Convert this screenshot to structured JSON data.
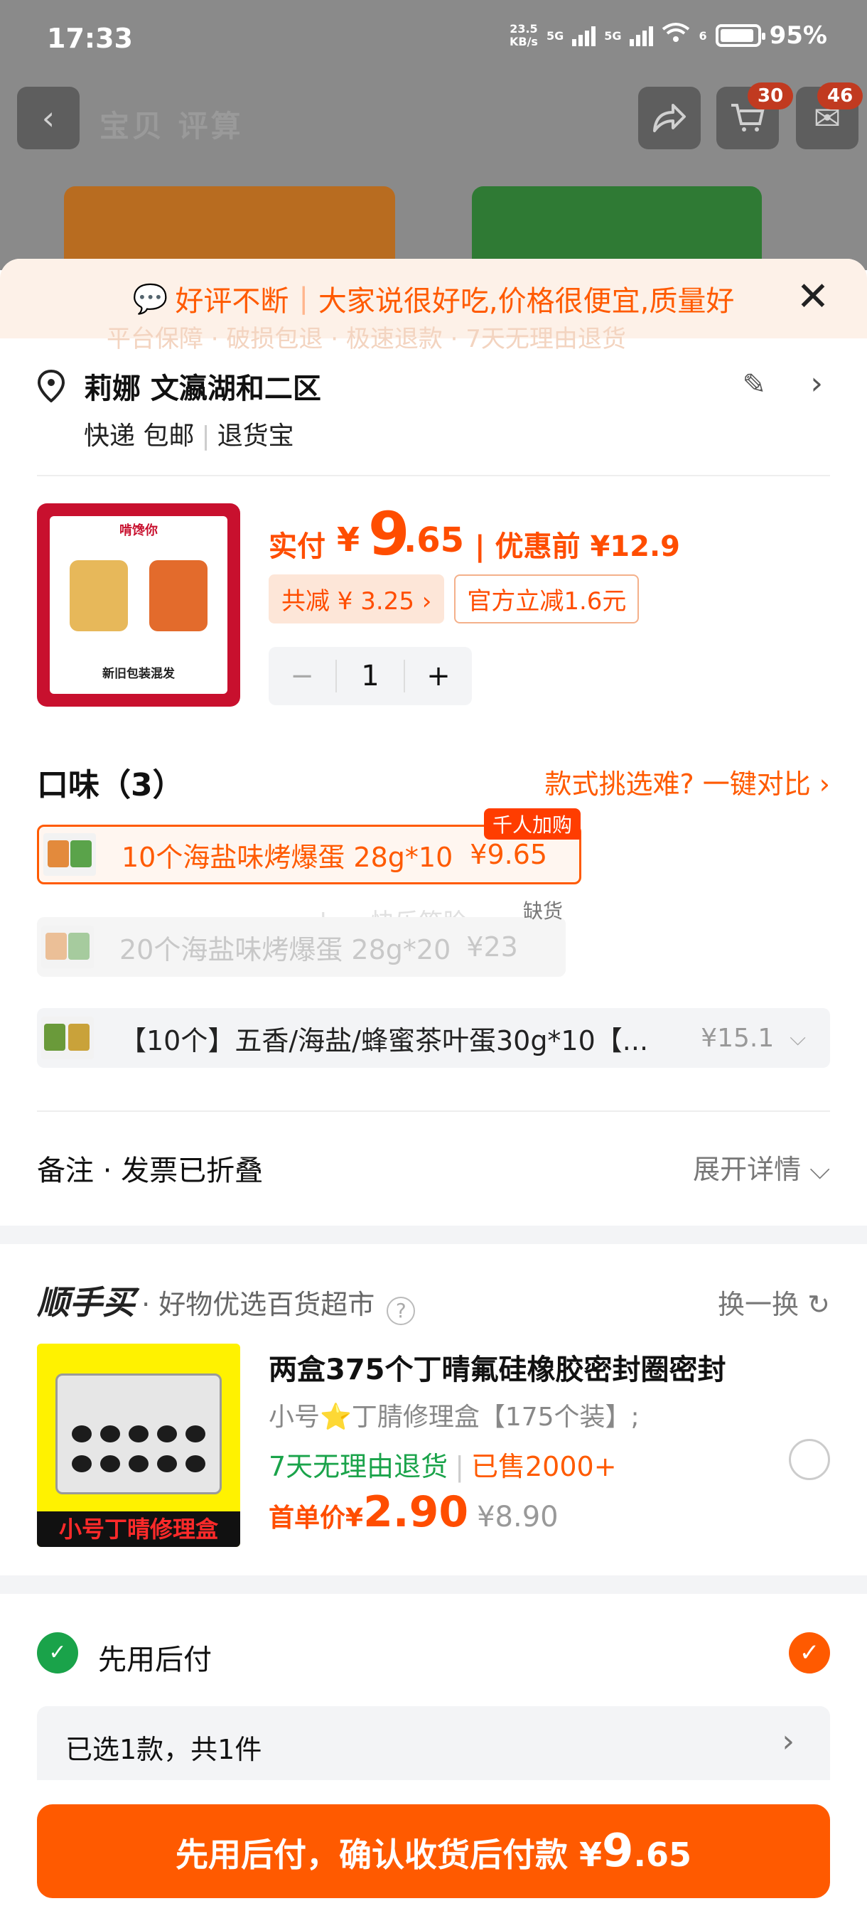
{
  "status_bar": {
    "time": "17:33",
    "net_speed": "23.5",
    "net_unit": "KB/s",
    "sig1": "5G",
    "sig2": "5G",
    "wifi_sub": "6",
    "battery": "95%"
  },
  "header": {
    "title": "宝贝 评算",
    "cart_count": "30",
    "msg_count": "46"
  },
  "banner": {
    "prefix": "好评不断",
    "text": "大家说很好吃,价格很便宜,质量好",
    "ghost": "平台保障 · 破损包退 · 极速退款 · 7天无理由退货"
  },
  "address": {
    "name": "莉娜 文瀛湖和二区",
    "delivery": "快递 包邮",
    "service": "退货宝"
  },
  "product": {
    "brand": "啃馋你",
    "image_caption": "新旧包装混发",
    "pay_label": "实付",
    "currency": "¥",
    "price_int": "9",
    "price_dec": ".65",
    "orig_price": "| 优惠前 ¥12.9",
    "discount_tag": "共减 ¥ 3.25 ›",
    "official_tag": "官方立减1.6元",
    "qty_minus": "−",
    "qty": "1",
    "qty_plus": "+"
  },
  "flavor": {
    "title": "口味（3）",
    "compare": "款式挑选难? 一键对比 ›",
    "options": [
      {
        "label": "10个海盐味烤爆蛋 28g*10",
        "price": "¥9.65",
        "badge": "千人加购"
      },
      {
        "label": "20个海盐味烤爆蛋 28g*20",
        "price": "¥23",
        "badge": "缺货"
      },
      {
        "label": "【10个】五香/海盐/蜂蜜茶叶蛋30g*10【...",
        "price": "¥15.1"
      }
    ],
    "watermark": "love快乐笑脸"
  },
  "note": {
    "label": "备注 · 发票已折叠",
    "expand": "展开详情"
  },
  "recommend": {
    "logo": "顺手买",
    "subtitle": "· 好物优选百货超市",
    "swap": "换一换",
    "image_label": "小号丁晴修理盒",
    "title": "两盒375个丁晴氟硅橡胶密封圈密封",
    "spec": "小号⭐丁腈修理盒【175个装】;",
    "return_policy": "7天无理由退货",
    "sold": "已售2000+",
    "first_label": "首单价¥",
    "first_price": "2.90",
    "orig_price": "¥8.90"
  },
  "payment": {
    "method": "先用后付",
    "selected_summary": "已选1款，共1件",
    "cta_prefix": "先用后付，确认收货后付款 ¥",
    "cta_int": "9",
    "cta_dec": ".65"
  },
  "colors": {
    "accent": "#ff5a00",
    "green": "#1aa34a",
    "banner_bg": "#fdf1e8"
  }
}
